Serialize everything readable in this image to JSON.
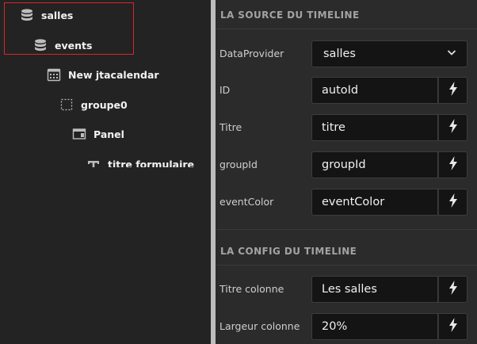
{
  "tree": {
    "items": [
      {
        "label": "salles",
        "icon": "database-icon"
      },
      {
        "label": "events",
        "icon": "database-icon"
      },
      {
        "label": "New jtacalendar",
        "icon": "calendar-icon"
      },
      {
        "label": "groupe0",
        "icon": "dashed-box-icon"
      },
      {
        "label": "Panel",
        "icon": "panel-icon"
      },
      {
        "label": "titre formulaire",
        "icon": "text-icon"
      }
    ],
    "selection_color": "#d7262b"
  },
  "sections": {
    "source_title": "LA SOURCE DU TIMELINE",
    "config_title": "LA CONFIG DU TIMELINE"
  },
  "props": {
    "dataprovider": {
      "label": "DataProvider",
      "value": "salles"
    },
    "id": {
      "label": "ID",
      "value": "autoId"
    },
    "titre": {
      "label": "Titre",
      "value": "titre"
    },
    "groupid": {
      "label": "groupId",
      "value": "groupId"
    },
    "eventcolor": {
      "label": "eventColor",
      "value": "eventColor"
    },
    "titre_colonne": {
      "label": "Titre colonne",
      "value": "Les salles"
    },
    "largeur_colonne": {
      "label": "Largeur colonne",
      "value": "20%"
    }
  }
}
